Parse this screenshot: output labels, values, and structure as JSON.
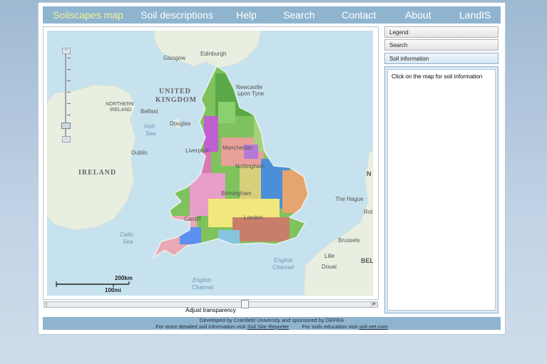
{
  "nav": {
    "items": [
      {
        "label": "Soilscapes map",
        "active": true
      },
      {
        "label": "Soil descriptions"
      },
      {
        "label": "Help"
      },
      {
        "label": "Search"
      },
      {
        "label": "Contact"
      },
      {
        "label": "About"
      },
      {
        "label": "LandIS"
      }
    ]
  },
  "map": {
    "labels": {
      "glasgow": "Glasgow",
      "edinburgh": "Edinburgh",
      "uk_1": "UNITED",
      "uk_2": "KINGDOM",
      "northern_ireland_1": "NORTHERN",
      "northern_ireland_2": "IRELAND",
      "belfast": "Belfast",
      "newcastle_1": "Newcastle",
      "newcastle_2": "upon Tyne",
      "irish_sea_1": "Irish",
      "irish_sea_2": "Sea",
      "douglas": "Douglas",
      "dublin": "Dublin",
      "ireland": "IRELAND",
      "liverpool": "Liverpool",
      "manchester": "Manchester",
      "nottingham": "Nottingham",
      "birmingham": "Birmingham",
      "the_hague": "The Hague",
      "rotterdam": "Rot",
      "brussels": "Brussels",
      "lille": "Lille",
      "douai": "Douai",
      "belgium": "BEL",
      "netherlands": "N",
      "cardiff": "Cardiff",
      "london": "London",
      "celtic_sea_1": "Celtic",
      "celtic_sea_2": "Sea",
      "english_channel_1": "English",
      "english_channel_2": "Channel",
      "english_channel_3": "English",
      "english_channel_4": "Channel"
    },
    "scale": {
      "km": "200km",
      "mi": "100mi"
    },
    "zoom": {
      "in": "+",
      "out": "−",
      "level_fraction": 0.9
    }
  },
  "transparency": {
    "label": "Adjust transparency",
    "value_fraction": 0.6
  },
  "sidebar": {
    "legend_label": "Legend",
    "search_label": "Search",
    "soil_info_label": "Soil information",
    "soil_info_message": "Click on the map for soil information"
  },
  "footer": {
    "line1": "Developed by Cranfield University and sponsored by DEFRA",
    "line2_prefix": "For more detailed soil information visit",
    "line2_link": "Soil Site Reporter",
    "line2b_prefix": "For soils education visit",
    "line2b_link": "soil-net.com"
  },
  "colors": {
    "nav_bg": "#8fb4cf",
    "nav_active": "#eef392",
    "sea": "#c7e2ef",
    "land": "#e8eee0"
  }
}
